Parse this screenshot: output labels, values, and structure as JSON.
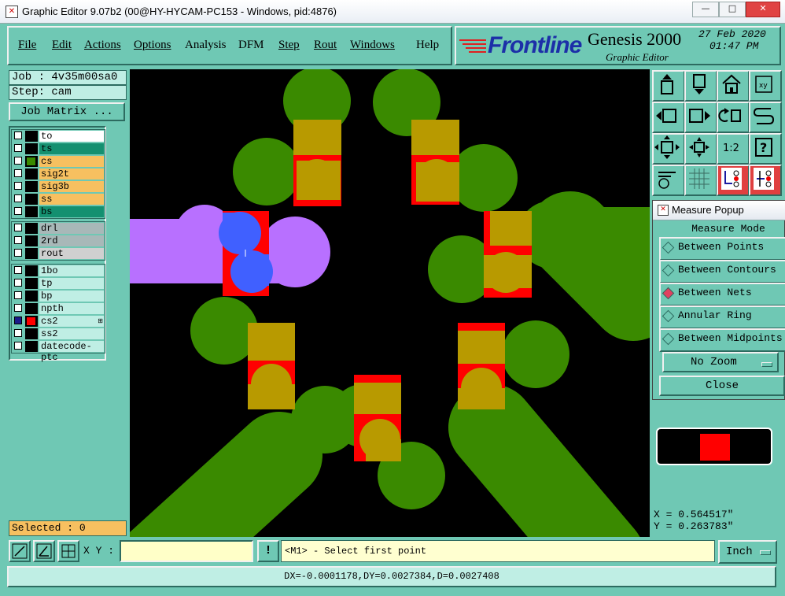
{
  "window": {
    "title": "Graphic Editor 9.07b2 (00@HY-HYCAM-PC153 - Windows, pid:4876)",
    "controls": [
      "—",
      "□",
      "✕"
    ]
  },
  "menu": {
    "items": [
      "File",
      "Edit",
      "Actions",
      "Options",
      "Analysis",
      "DFM",
      "Step",
      "Rout",
      "Windows",
      "Help"
    ]
  },
  "logo": {
    "brand": "Frontline",
    "product": "Genesis 2000",
    "subtitle": "Graphic Editor",
    "date": "27 Feb 2020",
    "time": "01:47 PM"
  },
  "job": {
    "job_line": "Job : 4v35m00sa0",
    "step_line": "Step: cam",
    "matrix_button": "Job Matrix ..."
  },
  "layers": {
    "groups": [
      [
        {
          "name": "to",
          "color": "#ffffff",
          "affected": false
        },
        {
          "name": "ts",
          "color": "#149070",
          "affected": false
        },
        {
          "name": "cs",
          "color": "#f7c060",
          "affected": false,
          "display_color": "#3a8a00"
        },
        {
          "name": "sig2t",
          "color": "#f7c060",
          "affected": false
        },
        {
          "name": "sig3b",
          "color": "#f7c060",
          "affected": false
        },
        {
          "name": "ss",
          "color": "#f7c060",
          "affected": false
        },
        {
          "name": "bs",
          "color": "#149070",
          "affected": false
        }
      ],
      [
        {
          "name": "drl",
          "color": "#a8b8b8",
          "affected": false
        },
        {
          "name": "2rd",
          "color": "#a8b8b8",
          "affected": false
        },
        {
          "name": "rout",
          "color": "#d0d0d0",
          "affected": false
        }
      ],
      [
        {
          "name": "1bo",
          "color": "#bfeee4",
          "affected": false
        },
        {
          "name": "tp",
          "color": "#bfeee4",
          "affected": false
        },
        {
          "name": "bp",
          "color": "#bfeee4",
          "affected": false
        },
        {
          "name": "npth",
          "color": "#bfeee4",
          "affected": false
        },
        {
          "name": "cs2",
          "color": "#bfeee4",
          "affected": true,
          "display_color": "#ff0000",
          "marker": "⊞"
        },
        {
          "name": "ss2",
          "color": "#bfeee4",
          "affected": false
        },
        {
          "name": "datecode-ptc",
          "color": "#bfeee4",
          "affected": false
        }
      ]
    ],
    "selected_label": "Selected : 0"
  },
  "toolbar": {
    "buttons": [
      "pan-up-icon",
      "pan-down-icon",
      "home-icon",
      "zoom-window-icon",
      "pan-left-icon",
      "pan-right-icon",
      "undo-zoom-icon",
      "redraw-icon",
      "zoom-fit-icon",
      "zoom-center-icon",
      "zoom-1to1-icon",
      "help-icon",
      "snap-settings-icon",
      "grid-icon",
      "measure-icon",
      "net-highlight-icon"
    ],
    "zoom_label": "1:2"
  },
  "measure": {
    "title": "Measure Popup",
    "mode_label": "Measure Mode",
    "options": [
      "Between Points",
      "Between Contours",
      "Between Nets",
      "Annular Ring",
      "Between Midpoints"
    ],
    "selected_index": 2,
    "zoom_dropdown": "No Zoom",
    "close_button": "Close"
  },
  "preview": {
    "color": "#ff0000"
  },
  "coords": {
    "x_line": "X = 0.564517\"",
    "y_line": "Y = 0.263783\""
  },
  "bottom": {
    "xy_label": "X Y :",
    "xy_value": "",
    "prompt": "<M1> - Select first point",
    "units": "Inch",
    "status": "DX=-0.0001178,DY=0.0027384,D=0.0027408"
  },
  "colors": {
    "panel": "#6fc8b4",
    "canvas_bg": "#000000",
    "copper": "#3a8a00",
    "pad_red": "#ff0000",
    "overlap": "#b89a00",
    "blue_net": "#4060ff",
    "violet_net": "#b870ff"
  }
}
